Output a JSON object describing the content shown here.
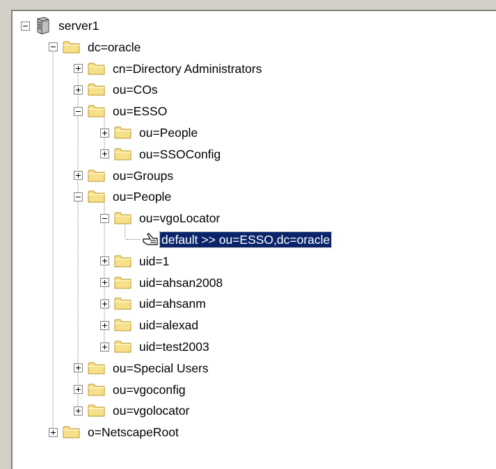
{
  "tree": {
    "server": {
      "label": "server1",
      "expanded": true
    },
    "root": {
      "label": "dc=oracle",
      "expanded": true
    },
    "level1": [
      {
        "label": "cn=Directory Administrators",
        "expanded": false
      },
      {
        "label": "ou=COs",
        "expanded": false
      },
      {
        "label": "ou=ESSO",
        "expanded": true
      },
      {
        "label": "ou=Groups",
        "expanded": false
      },
      {
        "label": "ou=People",
        "expanded": true
      },
      {
        "label": "ou=Special Users",
        "expanded": false
      },
      {
        "label": "ou=vgoconfig",
        "expanded": false
      },
      {
        "label": "ou=vgolocator",
        "expanded": false
      }
    ],
    "esso_children": [
      {
        "label": "ou=People",
        "expanded": false
      },
      {
        "label": "ou=SSOConfig",
        "expanded": false
      }
    ],
    "people_children": [
      {
        "label": "ou=vgoLocator",
        "expanded": true
      },
      {
        "label": "uid=1",
        "expanded": false
      },
      {
        "label": "uid=ahsan2008",
        "expanded": false
      },
      {
        "label": "uid=ahsanm",
        "expanded": false
      },
      {
        "label": "uid=alexad",
        "expanded": false
      },
      {
        "label": "uid=test2003",
        "expanded": false
      }
    ],
    "locator_entry": {
      "label": "default  >>  ou=ESSO,dc=oracle",
      "selected": true
    },
    "netscape_root": {
      "label": "o=NetscapeRoot",
      "expanded": false
    }
  },
  "icons": {
    "server": "server-icon",
    "folder": "folder-icon",
    "pointer": "hand-pointer-icon",
    "expand": "plus-box-icon",
    "collapse": "minus-box-icon"
  },
  "colors": {
    "selection_bg": "#0a246a",
    "selection_fg": "#ffffff",
    "folder_fill": "#f7e08a",
    "folder_stroke": "#b8952a",
    "window_bg": "#d4d0c8"
  }
}
